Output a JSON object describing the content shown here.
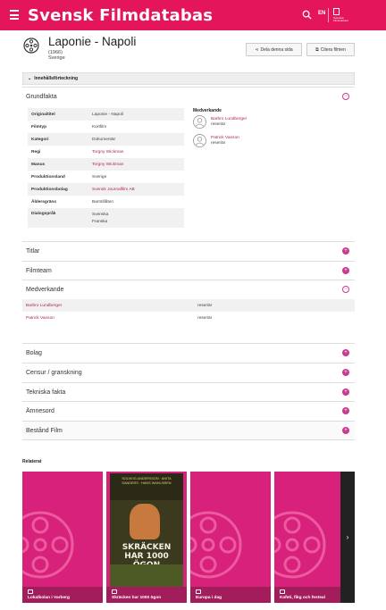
{
  "header": {
    "site_title": "Svensk Filmdatabas",
    "lang": "EN",
    "logo_text": "Svenska Filminstitutet",
    "accent": "#e4155a"
  },
  "film": {
    "title": "Laponie - Napoli",
    "year": "(1966)",
    "country": "Sverige",
    "share_label": "Dela denna sida",
    "cite_label": "Citera filmen"
  },
  "toc": {
    "label": "Innehållsförteckning"
  },
  "sections": {
    "grundfakta": "Grundfakta",
    "titlar": "Titlar",
    "filmteam": "Filmteam",
    "medverkande": "Medverkande",
    "bolag": "Bolag",
    "censur": "Censur / granskning",
    "tekniska": "Tekniska fakta",
    "amnesord": "Ämnesord",
    "bestand": "Bestånd Film"
  },
  "facts": [
    {
      "label": "Originaltitel",
      "value": "Laponie - Napoli",
      "link": false
    },
    {
      "label": "Filmtyp",
      "value": "Kortfilm",
      "link": false
    },
    {
      "label": "Kategori",
      "value": "Dokumentär",
      "link": false
    },
    {
      "label": "Regi",
      "value": "Torgny Wickman",
      "link": true
    },
    {
      "label": "Manus",
      "value": "Torgny Wickman",
      "link": true
    },
    {
      "label": "Produktionsland",
      "value": "Sverige",
      "link": false
    },
    {
      "label": "Produktionsbolag",
      "value": "Svensk Journalfilm AB",
      "link": true
    },
    {
      "label": "Åldersgräns",
      "value": "Barntillåten",
      "link": false
    },
    {
      "label": "Dialogspråk",
      "values": [
        "Svenska",
        "Franska"
      ],
      "link": false
    }
  ],
  "cast": {
    "title": "Medverkande",
    "items": [
      {
        "name": "Barbro Lundberger",
        "role": "reseriär"
      },
      {
        "name": "Patrick Vanson",
        "role": "reseriär"
      }
    ]
  },
  "medverkande_table": [
    {
      "name": "Barbro Lundberger",
      "role": "reseriär"
    },
    {
      "name": "Patrick Vanson",
      "role": "reseriär"
    }
  ],
  "related": {
    "title": "Relaterat",
    "cards": [
      {
        "caption": "Lokalkolan i Varberg"
      },
      {
        "caption": "Skräcken har 1000 ögon"
      },
      {
        "caption": "Europa i dag"
      },
      {
        "caption": "Kafeti, fikg och festeal"
      }
    ],
    "poster": {
      "top_text": "SOLVEIG ANDERSSON · ANITA SANDERS · HANS WAHLGREN",
      "big_text": "SKRÄCKEN HAR 1000 ÖGON"
    },
    "next_arrow": "›"
  }
}
